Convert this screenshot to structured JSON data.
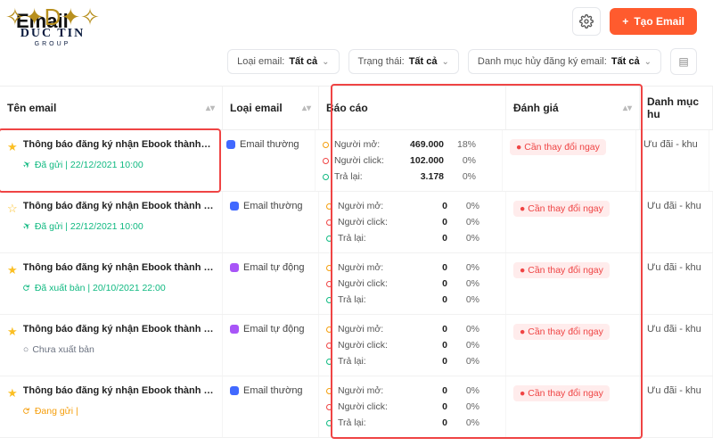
{
  "header": {
    "title": "Email",
    "create_btn": "Tạo Email"
  },
  "logo": {
    "main": "DUC TIN",
    "sub": "GROUP"
  },
  "filters": {
    "type_label": "Loại email:",
    "type_value": "Tất cả",
    "status_label": "Trạng thái:",
    "status_value": "Tất cả",
    "unsub_label": "Danh mục hủy đăng ký email:",
    "unsub_value": "Tất cả"
  },
  "columns": {
    "name": "Tên email",
    "type": "Loại email",
    "report": "Báo cáo",
    "rating": "Đánh giá",
    "category": "Danh mục hu"
  },
  "report_labels": {
    "open": "Người mở:",
    "click": "Người click:",
    "bounce": "Trả lại:"
  },
  "rating_text": "Cần thay đổi ngay",
  "category_text": "Ưu đãi - khu",
  "rows": [
    {
      "starred": true,
      "name": "Thông báo đăng ký nhận Ebook thành c...",
      "status_kind": "sent",
      "status_text": "Đã gửi | 22/12/2021 10:00",
      "type_color": "blue",
      "type_text": "Email thường",
      "open_v": "469.000",
      "open_p": "18%",
      "click_v": "102.000",
      "click_p": "0%",
      "bounce_v": "3.178",
      "bounce_p": "0%",
      "highlight": true
    },
    {
      "starred": false,
      "name": "Thông báo đăng ký nhận Ebook thành c...",
      "status_kind": "sent",
      "status_text": "Đã gửi | 22/12/2021 10:00",
      "type_color": "blue",
      "type_text": "Email thường",
      "open_v": "0",
      "open_p": "0%",
      "click_v": "0",
      "click_p": "0%",
      "bounce_v": "0",
      "bounce_p": "0%"
    },
    {
      "starred": true,
      "name": "Thông báo đăng ký nhận Ebook thành c...",
      "status_kind": "pub",
      "status_text": "Đã xuất bản | 20/10/2021  22:00",
      "type_color": "purple",
      "type_text": "Email tự động",
      "open_v": "0",
      "open_p": "0%",
      "click_v": "0",
      "click_p": "0%",
      "bounce_v": "0",
      "bounce_p": "0%"
    },
    {
      "starred": true,
      "name": "Thông báo đăng ký nhận Ebook thành c...",
      "status_kind": "draft",
      "status_text": "Chưa xuất bản",
      "type_color": "purple",
      "type_text": "Email tự động",
      "open_v": "0",
      "open_p": "0%",
      "click_v": "0",
      "click_p": "0%",
      "bounce_v": "0",
      "bounce_p": "0%"
    },
    {
      "starred": true,
      "name": "Thông báo đăng ký nhận Ebook thành c...",
      "status_kind": "sending",
      "status_text": "Đang gửi | ",
      "type_color": "blue",
      "type_text": "Email thường",
      "open_v": "0",
      "open_p": "0%",
      "click_v": "0",
      "click_p": "0%",
      "bounce_v": "0",
      "bounce_p": "0%"
    }
  ]
}
